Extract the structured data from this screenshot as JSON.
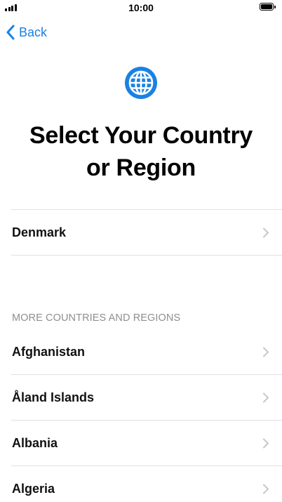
{
  "status_bar": {
    "time": "10:00",
    "signal_bars": 4,
    "battery_level": 1.0
  },
  "nav": {
    "back_label": "Back"
  },
  "header": {
    "icon": "globe-icon",
    "title_line1": "Select Your Country",
    "title_line2": "or Region"
  },
  "suggested": {
    "items": [
      {
        "label": "Denmark"
      }
    ]
  },
  "more": {
    "header": "MORE COUNTRIES AND REGIONS",
    "items": [
      {
        "label": "Afghanistan"
      },
      {
        "label": "Åland Islands"
      },
      {
        "label": "Albania"
      },
      {
        "label": "Algeria"
      }
    ]
  },
  "colors": {
    "accent": "#1a82e2",
    "section_header": "#8e8e93",
    "divider": "#e0e0e3",
    "chevron": "#c7c7cc"
  }
}
